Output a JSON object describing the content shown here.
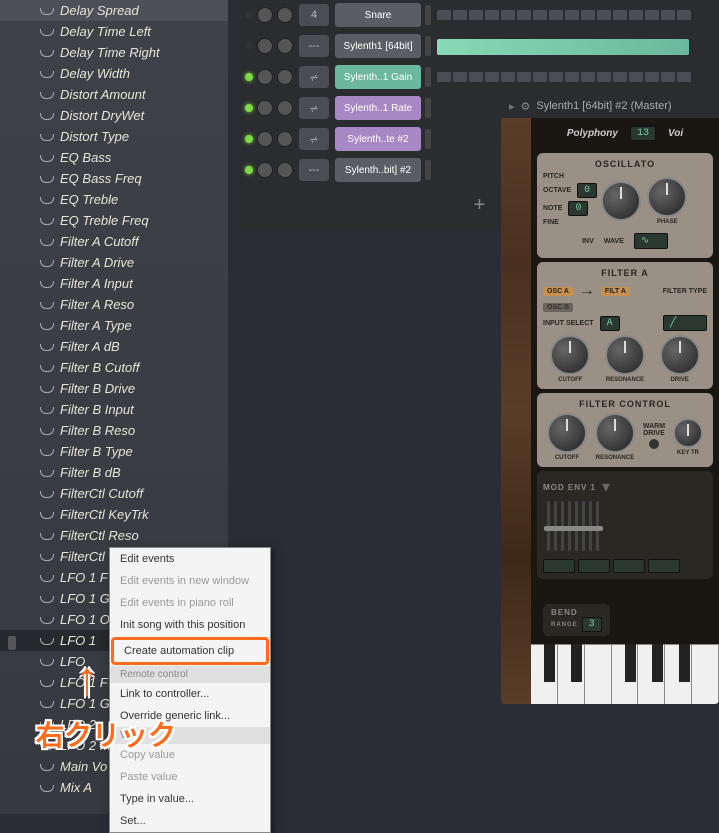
{
  "browser": {
    "params": [
      "Delay Spread",
      "Delay Time Left",
      "Delay Time Right",
      "Delay Width",
      "Distort Amount",
      "Distort DryWet",
      "Distort Type",
      "EQ Bass",
      "EQ Bass Freq",
      "EQ Treble",
      "EQ Treble Freq",
      "Filter A Cutoff",
      "Filter A Drive",
      "Filter A Input",
      "Filter A Reso",
      "Filter A Type",
      "Filter A dB",
      "Filter B Cutoff",
      "Filter B Drive",
      "Filter B Input",
      "Filter B Reso",
      "Filter B Type",
      "Filter B dB",
      "FilterCtl Cutoff",
      "FilterCtl KeyTrk",
      "FilterCtl Reso",
      "FilterCtl",
      "LFO 1 F",
      "LFO 1 G",
      "LFO 1 O",
      "LFO 1",
      "LFO",
      "LFO 1 F",
      "LFO 1 G",
      "LFO 2",
      "LFO 2 M",
      "Main Vo",
      "Mix A"
    ],
    "selected_index": 30
  },
  "channels": [
    {
      "num": "4",
      "name": "Snare",
      "cls": "grey",
      "led": false,
      "type": "steps"
    },
    {
      "num": "---",
      "name": "Sylenth1 [64bit]",
      "cls": "grey",
      "led": false,
      "type": "bar"
    },
    {
      "num": "",
      "name": "Sylenth..1 Gain",
      "cls": "teal",
      "led": true,
      "type": "steps"
    },
    {
      "num": "",
      "name": "Sylenth..1 Rate",
      "cls": "purple",
      "led": true,
      "type": "none"
    },
    {
      "num": "",
      "name": "Sylenth..te #2",
      "cls": "purple",
      "led": true,
      "type": "none"
    },
    {
      "num": "---",
      "name": "Sylenth..bit] #2",
      "cls": "grey",
      "led": true,
      "type": "none"
    }
  ],
  "add_label": "+",
  "plugin": {
    "title": "Sylenth1 [64bit] #2 (Master)",
    "polyphony_label": "Polyphony",
    "polyphony_value": "13",
    "voice_label": "Voi",
    "osc_title": "OSCILLATO",
    "osc_labels": {
      "pitch": "PITCH",
      "octave": "OCTAVE",
      "note": "NOTE",
      "fine": "FINE",
      "inv": "INV",
      "wave": "WAVE",
      "phase": "PHASE"
    },
    "octave_val": "0",
    "note_val": "0",
    "filter_a_title": "FILTER A",
    "osc_a": "OSC A",
    "osc_b": "OSC B",
    "filt_a": "FILT A",
    "input_select": "INPUT SELECT",
    "input_val": "A",
    "filter_type": "FILTER TYPE",
    "cutoff": "CUTOFF",
    "resonance": "RESONANCE",
    "drive": "DRIVE",
    "filter_ctrl_title": "FILTER CONTROL",
    "warm": "WARM",
    "drive2": "DRIVE",
    "keytr": "KEY TR",
    "modenv_title": "MOD ENV 1",
    "bend_label": "BEND",
    "range_label": "RANGE",
    "range_val": "3"
  },
  "context_menu": {
    "edit_events": "Edit events",
    "edit_new_window": "Edit events in new window",
    "edit_piano": "Edit events in piano roll",
    "init_song": "Init song with this position",
    "create_clip": "Create automation clip",
    "remote_header": "Remote control",
    "link_controller": "Link to controller...",
    "override": "Override generic link...",
    "value_header": "Value",
    "copy_value": "Copy value",
    "paste_value": "Paste value",
    "type_value": "Type in value...",
    "set": "Set..."
  },
  "annotation": "右クリック"
}
